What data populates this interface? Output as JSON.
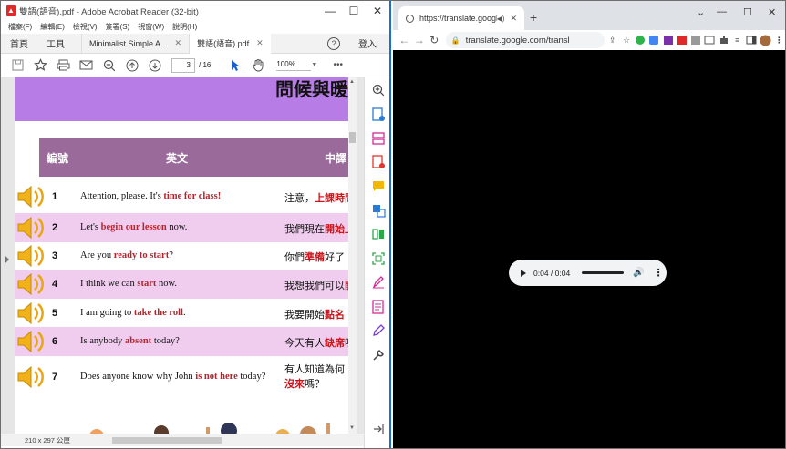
{
  "acrobat": {
    "title": "雙語(語音).pdf - Adobe Acrobat Reader (32-bit)",
    "menus": [
      "檔案(F)",
      "編輯(E)",
      "檢視(V)",
      "簽署(S)",
      "視窗(W)",
      "說明(H)"
    ],
    "nav_home": "首頁",
    "nav_tools": "工具",
    "tabs": [
      {
        "label": "Minimalist Simple A..."
      },
      {
        "label": "雙語(語音).pdf"
      }
    ],
    "help": "?",
    "login": "登入",
    "page_current": "3",
    "page_total": "/ 16",
    "zoom": "100%",
    "more": "•••",
    "page_size": "210 x 297 公厘"
  },
  "pdf": {
    "banner_title": "問候與暖",
    "headers": {
      "num": "編號",
      "en": "英文",
      "zh": "中譯"
    },
    "rows": [
      {
        "num": "1",
        "en_pre": "Attention, please. It's ",
        "en_hl": "time for class!",
        "en_post": "",
        "zh_pre": "注意，",
        "zh_hl": "上課時間",
        "zh_post": "",
        "pink": false
      },
      {
        "num": "2",
        "en_pre": "Let's ",
        "en_hl": "begin our lesson",
        "en_post": " now.",
        "zh_pre": "我們現在",
        "zh_hl": "開始上",
        "zh_post": "",
        "pink": true
      },
      {
        "num": "3",
        "en_pre": "Are you ",
        "en_hl": "ready to start",
        "en_post": "?",
        "zh_pre": "你們",
        "zh_hl": "準備",
        "zh_post": "好了",
        "pink": false
      },
      {
        "num": "4",
        "en_pre": "I think we can ",
        "en_hl": "start",
        "en_post": " now.",
        "zh_pre": "我想我們可以",
        "zh_hl": "開",
        "zh_post": "",
        "pink": true
      },
      {
        "num": "5",
        "en_pre": "I am going to ",
        "en_hl": "take the roll",
        "en_post": ".",
        "zh_pre": "我要開始",
        "zh_hl": "點名",
        "zh_post": "",
        "pink": false
      },
      {
        "num": "6",
        "en_pre": "Is anybody ",
        "en_hl": "absent",
        "en_post": " today?",
        "zh_pre": "今天有人",
        "zh_hl": "缺席",
        "zh_post": "嗎",
        "pink": true
      },
      {
        "num": "7",
        "en_pre": "Does anyone know why John ",
        "en_hl": "is not here",
        "en_post": " today?",
        "zh_pre": "有人知道為何",
        "zh_hl": "",
        "zh_post": "",
        "zh2_hl": "沒來",
        "zh2_post": "嗎？",
        "pink": false
      }
    ]
  },
  "chrome": {
    "tab_title": "https://translate.google.co",
    "url": "translate.google.com/transl",
    "player_time": "0:04 / 0:04"
  }
}
